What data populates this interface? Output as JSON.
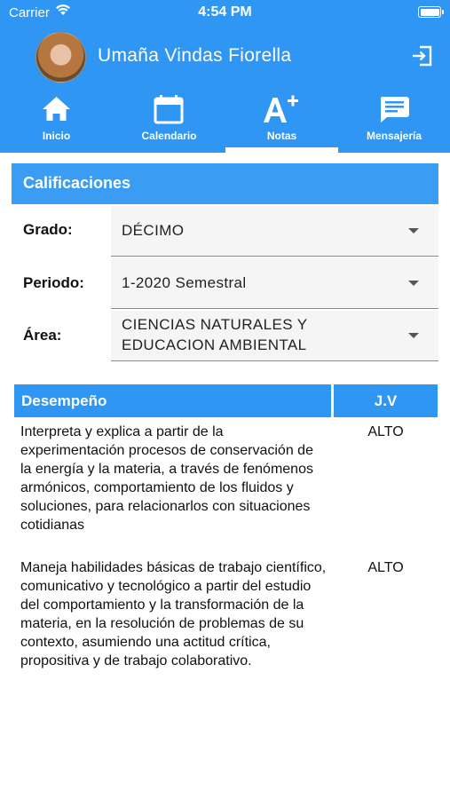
{
  "status_bar": {
    "carrier": "Carrier",
    "time": "4:54 PM"
  },
  "header": {
    "user_name": "Umaña Vindas Fiorella"
  },
  "tabs": [
    {
      "label": "Inicio",
      "icon": "home-icon"
    },
    {
      "label": "Calendario",
      "icon": "calendar-icon"
    },
    {
      "label": "Notas",
      "icon": "grade-a-plus-icon"
    },
    {
      "label": "Mensajería",
      "icon": "message-icon"
    }
  ],
  "active_tab": "Notas",
  "section_title": "Calificaciones",
  "filters": {
    "grado": {
      "label": "Grado:",
      "value": "DÉCIMO"
    },
    "periodo": {
      "label": "Periodo:",
      "value": "1-2020 Semestral"
    },
    "area": {
      "label": "Área:",
      "value_line1": "CIENCIAS NATURALES Y",
      "value_line2": "EDUCACION AMBIENTAL"
    }
  },
  "table": {
    "headers": [
      "Desempeño",
      "J.V"
    ],
    "rows": [
      {
        "desempeno": "Interpreta y explica a partir de la experimentación procesos de conservación de la energía y la materia, a través de fenómenos armónicos, comportamiento de los fluidos y soluciones, para relacionarlos con situaciones cotidianas",
        "jv": "ALTO"
      },
      {
        "desempeno": "Maneja habilidades básicas de trabajo científico, comunicativo y tecnológico a partir del estudio del comportamiento y la transformación de la materia, en la resolución de problemas de su contexto, asumiendo una actitud crítica, propositiva y de trabajo colaborativo.",
        "jv": "ALTO"
      }
    ]
  },
  "colors": {
    "primary": "#2f96f3",
    "section_bar": "#3a9cf3",
    "select_bg": "#f5f5f5"
  }
}
